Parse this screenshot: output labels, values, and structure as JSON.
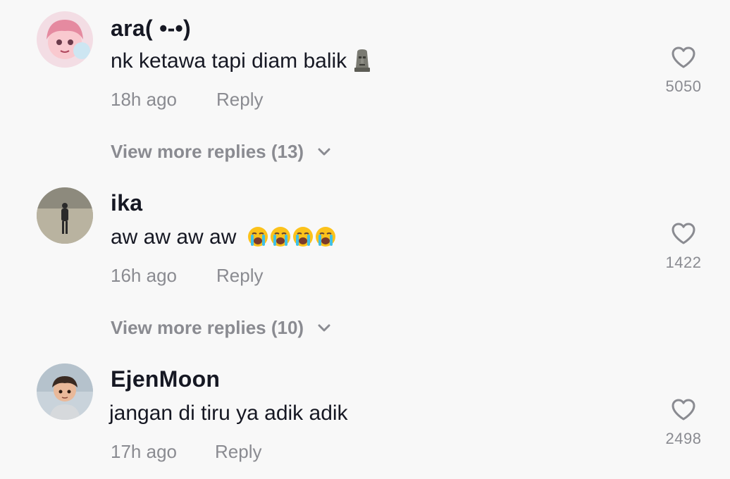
{
  "comments": [
    {
      "username": "ara( •-•)",
      "text": "nk ketawa tapi diam balik",
      "emoji": "moai",
      "time": "18h ago",
      "reply_label": "Reply",
      "likes": "5050",
      "view_more": "View more replies (13)"
    },
    {
      "username": "ika",
      "text": "aw aw aw aw",
      "emoji": "loudly-crying-face x4",
      "time": "16h ago",
      "reply_label": "Reply",
      "likes": "1422",
      "view_more": "View more replies (10)"
    },
    {
      "username": "EjenMoon",
      "text": "jangan di tiru ya adik adik",
      "time": "17h ago",
      "reply_label": "Reply",
      "likes": "2498"
    }
  ],
  "colors": {
    "background": "#f8f8f8",
    "text_primary": "#161823",
    "text_secondary": "#8a8b91"
  }
}
